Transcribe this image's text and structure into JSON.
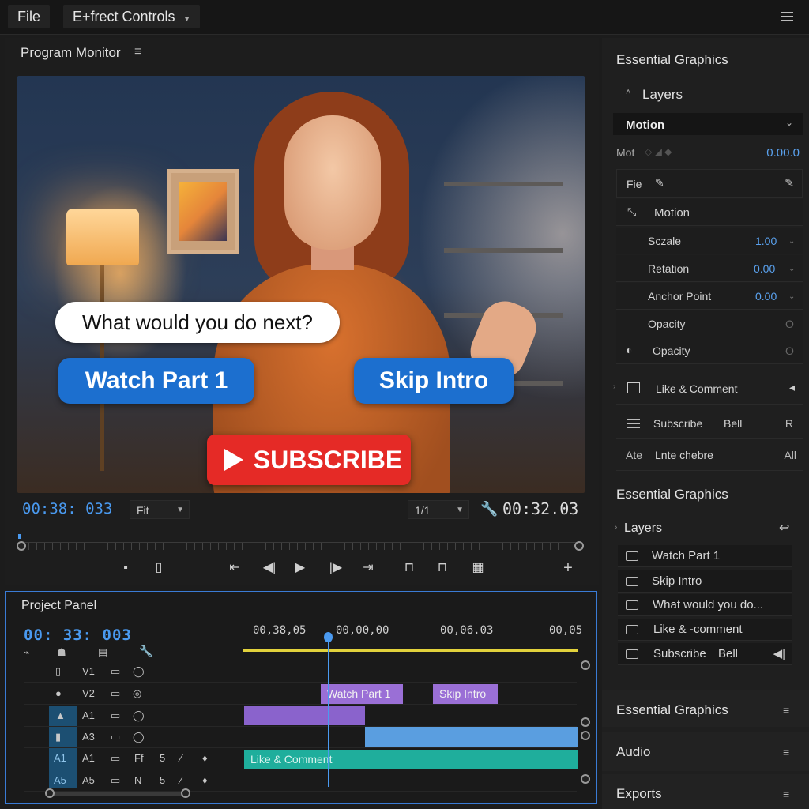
{
  "menubar": {
    "file": "File",
    "effect_controls": "E+frect Controls"
  },
  "monitor": {
    "title": "Program Monitor",
    "overlay_question": "What would you do next?",
    "overlay_watch": "Watch Part 1",
    "overlay_skip": "Skip Intro",
    "overlay_subscribe": "SUBSCRIBE",
    "timecode_current": "00:38: 033",
    "zoom_value": "Fit",
    "resolution_value": "1/1",
    "timecode_duration": "00:32.03"
  },
  "project": {
    "title": "Project Panel",
    "timecode": "00: 33: 003",
    "ruler": [
      "00,38,05",
      "00,00,00",
      "00,06.03",
      "00,05"
    ],
    "tracks": [
      {
        "id": "V1",
        "col3": "",
        "col4": ""
      },
      {
        "id": "V2",
        "col3": "",
        "col4": ""
      },
      {
        "id": "A1",
        "col3": "",
        "col4": ""
      },
      {
        "id": "A3",
        "col3": "",
        "col4": ""
      },
      {
        "id": "A1",
        "side": "A1",
        "col3": "Ff",
        "col4": "5"
      },
      {
        "id": "A5",
        "side": "A5",
        "col3": "N",
        "col4": "5"
      }
    ],
    "clips": {
      "watch": "Watch Part 1",
      "skip": "Skip Intro",
      "like": "Like & Comment"
    }
  },
  "right_panel": {
    "title": "Essential Graphics",
    "layers_label": "Layers",
    "motion_select": "Motion",
    "mot_label": "Mot",
    "mot_value": "0.00.0",
    "fie_label": "Fie",
    "motion_label": "Motion",
    "props": [
      {
        "name": "Sczale",
        "value": "1.00"
      },
      {
        "name": "Retation",
        "value": "0.00"
      },
      {
        "name": "Anchor Point",
        "value": "0.00"
      },
      {
        "name": "Opacity",
        "value": "O"
      }
    ],
    "opacity2_label": "Opacity",
    "opacity2_value": "O",
    "like_comment": "Like & Comment",
    "subscribe": "Subscribe",
    "bell": "Bell",
    "subscribe_key": "R",
    "ate_label": "Ate",
    "ate_value": "Lnte chebre",
    "ate_all": "All",
    "section2_title": "Essential Graphics",
    "layers2_label": "Layers",
    "layers": [
      "Watch Part 1",
      "Skip Intro",
      "What would you do...",
      "Like & -comment",
      "Subscribe"
    ],
    "layers_bell": "Bell",
    "section3_title": "Essential Graphics",
    "audio_title": "Audio",
    "exports_title": "Exports"
  }
}
